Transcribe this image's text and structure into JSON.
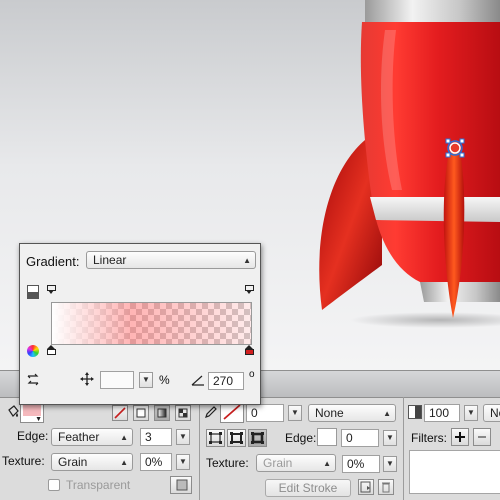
{
  "gradient_popup": {
    "label": "Gradient:",
    "type_value": "Linear",
    "offset_value": "",
    "percent_symbol": "%",
    "angle_value": "270",
    "degree_symbol": "o"
  },
  "fill": {
    "edge_label": "Edge:",
    "edge_value": "Feather",
    "edge_amount": "3",
    "texture_label": "Texture:",
    "texture_value": "Grain",
    "texture_amount": "0%",
    "transparent_label": "Transparent"
  },
  "stroke": {
    "width_value": "0",
    "style_value": "None",
    "edge_label": "Edge:",
    "edge_amount": "0",
    "texture_label": "Texture:",
    "texture_value": "Grain",
    "texture_amount": "0%",
    "edit_stroke_label": "Edit Stroke"
  },
  "effects": {
    "opacity_value": "100",
    "blend_value": "No",
    "filters_label": "Filters:"
  },
  "colors": {
    "rocket_red": "#e0191c",
    "fill_swatch": "#f5b9bd",
    "stroke_swatch": "#c81e1e",
    "stop_end": "#d11f1f"
  }
}
